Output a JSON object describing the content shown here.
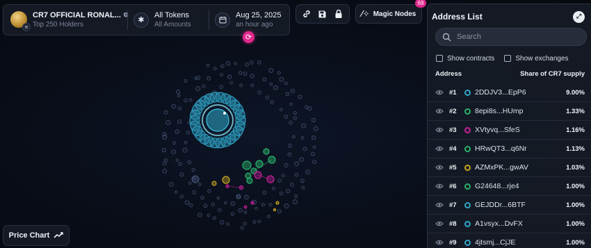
{
  "token": {
    "name": "CR7 OFFICIAL RONAL...",
    "holders": "Top 250 Holders",
    "badge": "≡"
  },
  "filter": {
    "title": "All Tokens",
    "sub": "All Amounts",
    "icon": "asterisk-icon"
  },
  "date": {
    "title": "Aug 25, 2025",
    "sub": "an hour ago",
    "icon": "calendar-icon"
  },
  "tools": [
    "link-icon",
    "save-icon",
    "lock-icon"
  ],
  "magic_nodes": {
    "label": "Magic Nodes",
    "count": "69"
  },
  "price_chart": {
    "label": "Price Chart"
  },
  "address_list": {
    "title": "Address List",
    "search_placeholder": "Search",
    "show_contracts": "Show contracts",
    "show_exchanges": "Show exchanges",
    "col_address": "Address",
    "col_share": "Share of CR7 supply",
    "rows": [
      {
        "rank": "#1",
        "address": "2DDJV3...EpP6",
        "share": "9.00%",
        "color": "#2fa7c9"
      },
      {
        "rank": "#2",
        "address": "8epi8s...HUmp",
        "share": "1.33%",
        "color": "#29b36a"
      },
      {
        "rank": "#3",
        "address": "XVtyvq...SfeS",
        "share": "1.16%",
        "color": "#c81e9a"
      },
      {
        "rank": "#4",
        "address": "HRwQT3...q6Nr",
        "share": "1.13%",
        "color": "#29b36a"
      },
      {
        "rank": "#5",
        "address": "AZMxPK...gwAV",
        "share": "1.03%",
        "color": "#c9a620"
      },
      {
        "rank": "#6",
        "address": "G24648...rje4",
        "share": "1.00%",
        "color": "#29b36a"
      },
      {
        "rank": "#7",
        "address": "GEJDDr...6BTF",
        "share": "1.00%",
        "color": "#2fa7c9"
      },
      {
        "rank": "#8",
        "address": "A1vsyx...DvFX",
        "share": "1.00%",
        "color": "#2fa7c9"
      },
      {
        "rank": "#9",
        "address": "4jtsmj...CjJE",
        "share": "1.00%",
        "color": "#2fa7c9"
      }
    ]
  },
  "colors": {
    "accent": "#e0288c",
    "cyan": "#2fa7c9",
    "green": "#29b36a",
    "magenta": "#c81e9a",
    "gold": "#c9a620",
    "node_outline": "#4a5878"
  }
}
